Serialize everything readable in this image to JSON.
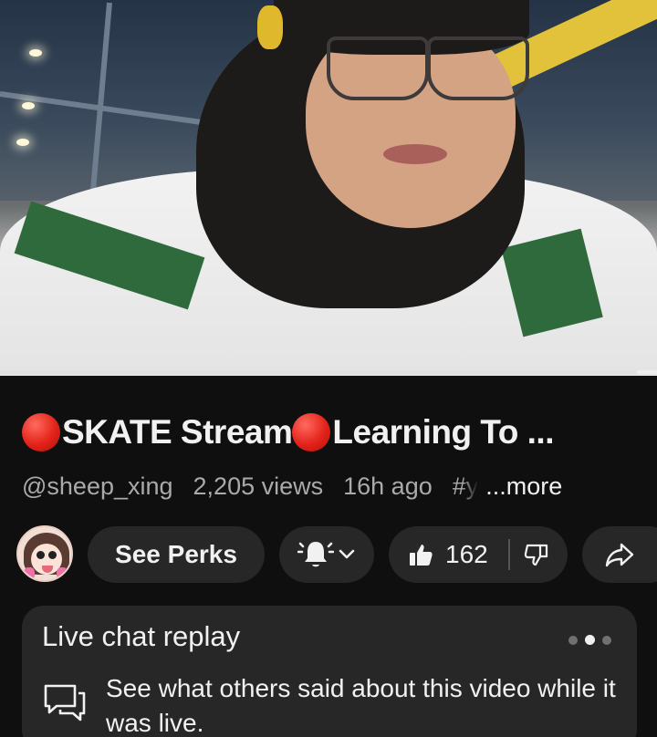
{
  "video": {
    "progress_fraction": 0.97
  },
  "title": {
    "part1": "SKATE Stream",
    "part2": "Learning To ..."
  },
  "meta": {
    "channel_handle": "@sheep_xing",
    "views": "2,205 views",
    "age": "16h ago",
    "hashtag": "#y",
    "more_label": "...more"
  },
  "actions": {
    "perks_label": "See Perks",
    "like_count": "162"
  },
  "live_chat": {
    "title": "Live chat replay",
    "description": "See what others said about this video while it was live.",
    "pager": {
      "count": 3,
      "active_index": 1
    }
  },
  "icons": {
    "live_dot": "red-circle-emoji",
    "bell": "bell-ringing-icon",
    "chevron": "chevron-down-icon",
    "like": "thumbs-up-icon",
    "dislike": "thumbs-down-icon",
    "share": "share-icon",
    "chat": "chat-bubbles-icon"
  },
  "colors": {
    "background": "#0f0f0f",
    "surface": "#272727",
    "text_primary": "#f1f1f1",
    "text_secondary": "#aaaaaa",
    "live_red": "#e2231a"
  }
}
